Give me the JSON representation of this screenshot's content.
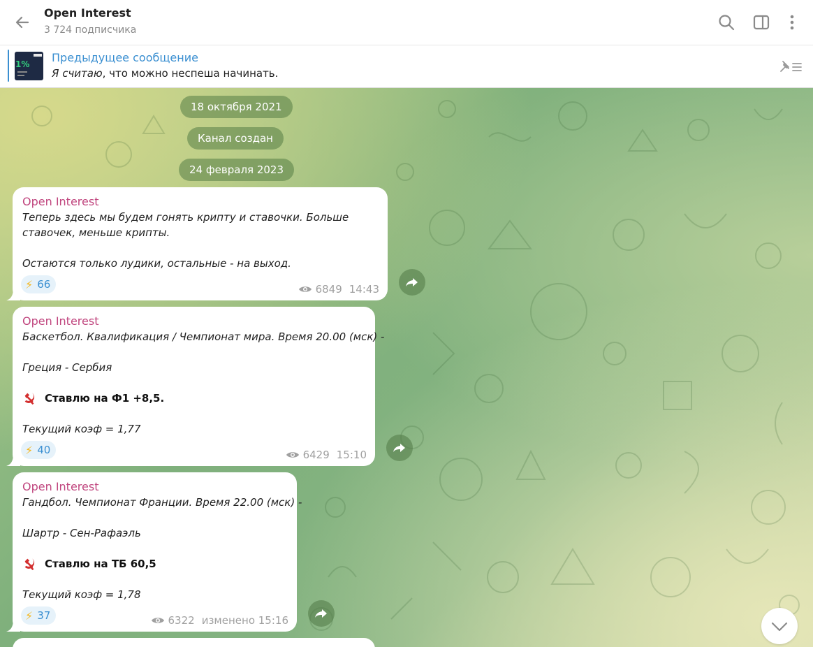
{
  "header": {
    "title": "Open Interest",
    "subtitle": "3 724 подписчика",
    "icons": [
      "back-arrow-icon",
      "search-icon",
      "sidebar-toggle-icon",
      "more-vertical-icon"
    ]
  },
  "pinned": {
    "title": "Предыдущее сообщение",
    "text_italic": "Я считаю",
    "text_rest": ", что можно неспеша начинать.",
    "thumb_percent": "1%"
  },
  "dates": [
    "18 октября 2021",
    "Канал создан",
    "24 февраля 2023"
  ],
  "messages": [
    {
      "sender": "Open Interest",
      "lines": [
        "Теперь здесь мы будем гонять крипту и ставочки. Больше",
        "ставочек, меньше крипты.",
        "",
        "Остаются только лудики, остальные - на выход."
      ],
      "reaction_count": "66",
      "views": "6849",
      "time": "14:43"
    },
    {
      "sender": "Open Interest",
      "line1": "Баскетбол. Квалификация / Чемпионат мира. Время 20.00 (мск) -",
      "line2": "Греция - Сербия",
      "bet": "Ставлю на Ф1 +8,5.",
      "odds": "Текущий коэф = 1,77",
      "reaction_count": "40",
      "views": "6429",
      "time": "15:10"
    },
    {
      "sender": "Open Interest",
      "line1": "Гандбол. Чемпионат Франции. Время 22.00 (мск) -",
      "line2": "Шартр - Сен-Рафаэль",
      "bet": "Ставлю на ТБ 60,5",
      "odds": "Текущий коэф = 1,78",
      "reaction_count": "37",
      "views": "6322",
      "time": "изменено 15:16"
    }
  ],
  "reaction_emoji": "⚡",
  "colors": {
    "accent": "#3a8fd1",
    "sender": "#c0457e",
    "meta": "#a0a0a0",
    "emoji_red": "#d32f2f"
  }
}
